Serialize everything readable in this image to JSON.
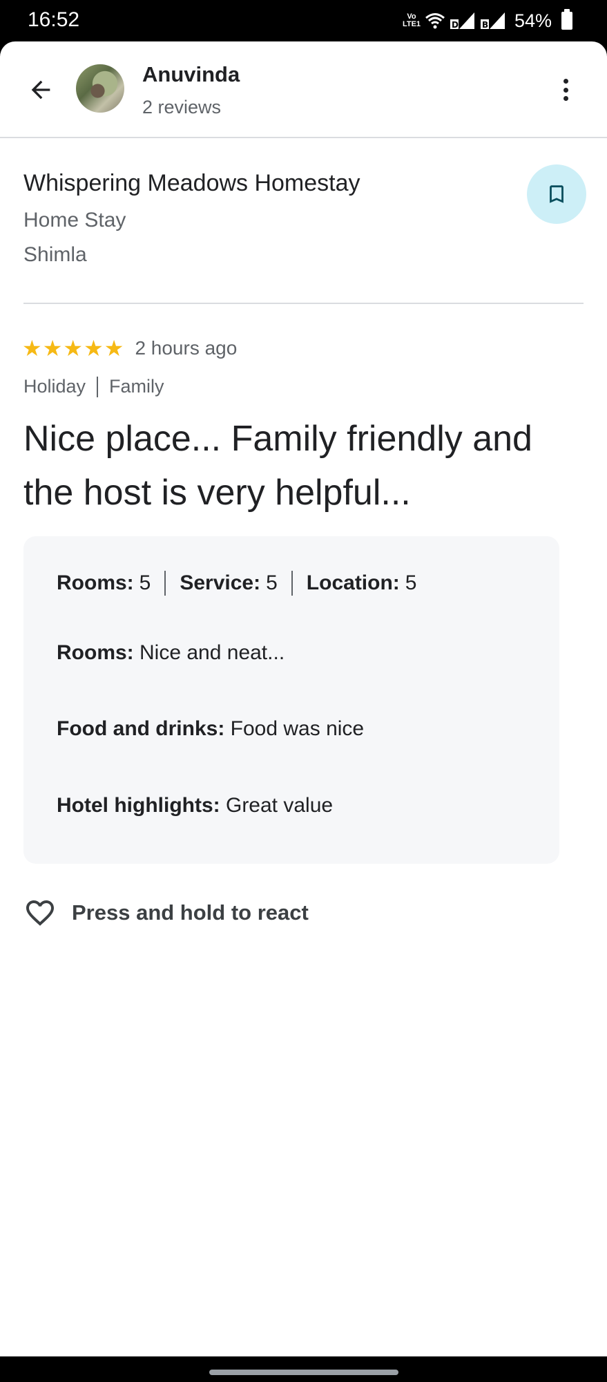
{
  "status_bar": {
    "time": "16:52",
    "network_label": "Vo LTE1",
    "battery": "54%"
  },
  "header": {
    "reviewer_name": "Anuvinda",
    "reviewer_reviews": "2 reviews",
    "avatar": "reviewer-photo",
    "back_icon": "arrow-left-icon",
    "menu_icon": "more-vertical-icon"
  },
  "place": {
    "name": "Whispering Meadows Homestay",
    "type": "Home Stay",
    "city": "Shimla",
    "save_icon": "bookmark-icon"
  },
  "review": {
    "rating": 5,
    "max_rating": 5,
    "time": "2 hours ago",
    "tags": [
      "Holiday",
      "Family"
    ],
    "text": "Nice place... Family friendly and the host is very helpful...",
    "aspect_ratings": [
      {
        "label": "Rooms:",
        "value": "5"
      },
      {
        "label": "Service:",
        "value": "5"
      },
      {
        "label": "Location:",
        "value": "5"
      }
    ],
    "details": [
      {
        "label": "Rooms:",
        "value": "Nice and neat..."
      },
      {
        "label": "Food and drinks:",
        "value": "Food was nice"
      },
      {
        "label": "Hotel highlights:",
        "value": "Great value"
      }
    ]
  },
  "reaction": {
    "label": "Press and hold to react",
    "icon": "heart-outline-icon"
  },
  "colors": {
    "star": "#f6b915",
    "save_button_bg": "#cdeff7",
    "card_bg": "#f6f7f9",
    "text_primary": "#202124",
    "text_secondary": "#5f6368"
  }
}
